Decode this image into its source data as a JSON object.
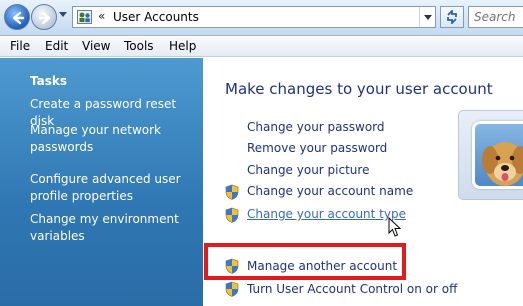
{
  "address_bar": {
    "chevron": "«",
    "path": "User Accounts",
    "search_placeholder": "Search"
  },
  "menu": [
    "File",
    "Edit",
    "View",
    "Tools",
    "Help"
  ],
  "sidebar": {
    "title": "Tasks",
    "links": [
      "Create a password reset disk",
      "Manage your network passwords",
      "Configure advanced user profile properties",
      "Change my environment variables"
    ]
  },
  "main": {
    "heading": "Make changes to your user account",
    "tasks": [
      {
        "label": "Change your password",
        "icon": "none"
      },
      {
        "label": "Remove your password",
        "icon": "none"
      },
      {
        "label": "Change your picture",
        "icon": "none"
      },
      {
        "label": "Change your account name",
        "icon": "uac-shield-icon"
      },
      {
        "label": "Change your account type",
        "icon": "uac-shield-icon"
      },
      {
        "label": "Manage another account",
        "icon": "uac-shield-icon"
      },
      {
        "label": "Turn User Account Control on or off",
        "icon": "uac-shield-icon"
      }
    ]
  },
  "colors": {
    "sidebar": "#2f77b3",
    "link": "#1e3287",
    "highlight": "#e11b1b"
  }
}
